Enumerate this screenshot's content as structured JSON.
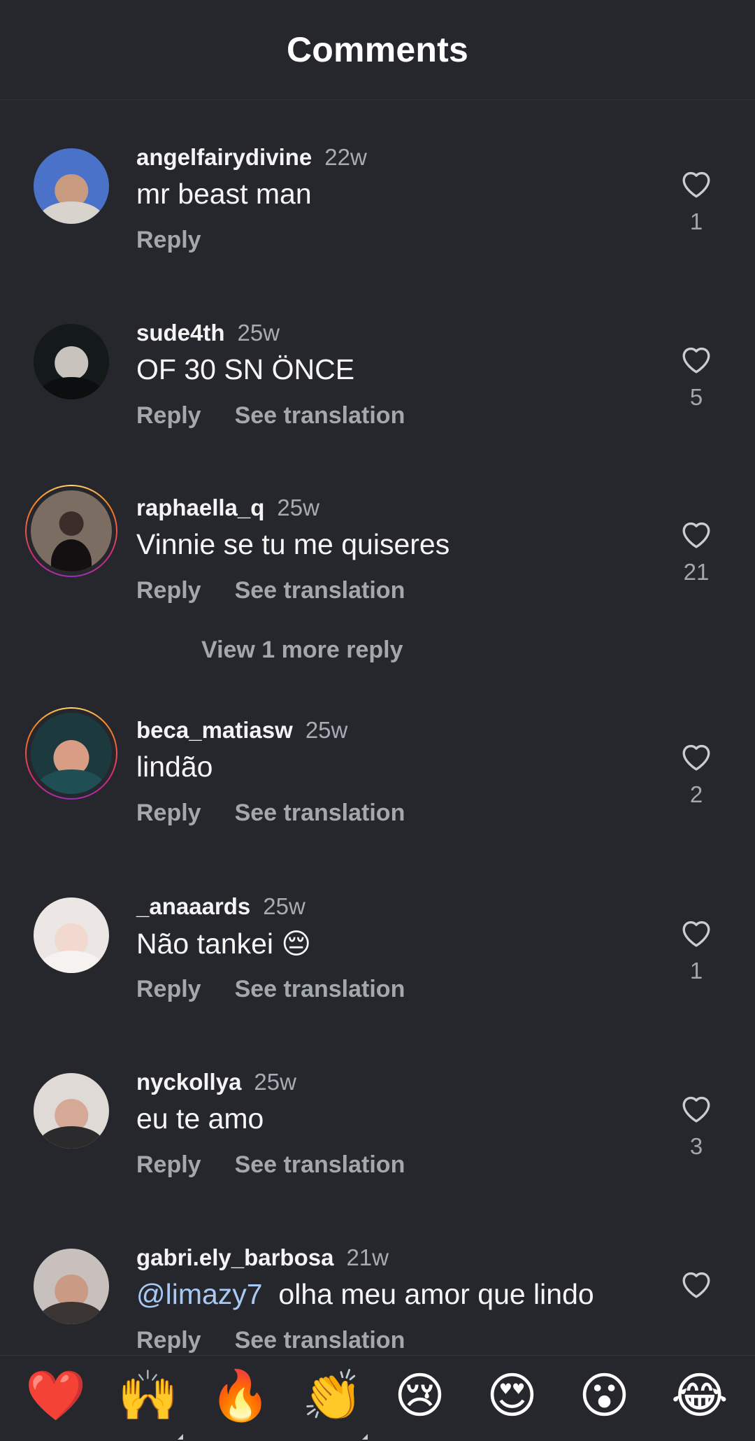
{
  "header": {
    "title": "Comments"
  },
  "comments": [
    {
      "username": "angelfairydivine",
      "time": "22w",
      "text": "mr beast man",
      "reply": "Reply",
      "translate": "",
      "likes": "1"
    },
    {
      "username": "sude4th",
      "time": "25w",
      "text": "OF 30 SN ÖNCE",
      "reply": "Reply",
      "translate": "See translation",
      "likes": "5"
    },
    {
      "username": "raphaella_q",
      "time": "25w",
      "text": "Vinnie se tu me quiseres",
      "reply": "Reply",
      "translate": "See translation",
      "likes": "21"
    },
    {
      "username": "beca_matiasw",
      "time": "25w",
      "text": "lindão",
      "reply": "Reply",
      "translate": "See translation",
      "likes": "2"
    },
    {
      "username": "_anaaards",
      "time": "25w",
      "text": "Não tankei 😔",
      "reply": "Reply",
      "translate": "See translation",
      "likes": "1"
    },
    {
      "username": "nyckollya",
      "time": "25w",
      "text": "eu te amo",
      "reply": "Reply",
      "translate": "See translation",
      "likes": "3"
    },
    {
      "username": "gabri.ely_barbosa",
      "time": "21w",
      "mention": "@limazy7",
      "text": "olha meu amor que lindo",
      "reply": "Reply",
      "translate": "See translation",
      "likes": ""
    }
  ],
  "view_more": "View 1 more reply",
  "emoji_bar": [
    "❤️",
    "🙌",
    "🔥",
    "👏",
    "😢",
    "😍",
    "😮",
    "😂"
  ],
  "icons": {
    "like": "heart-outline-icon"
  },
  "colors": {
    "background": "#25272c",
    "secondary_text": "#a3a7ae",
    "mention": "#a9c9f3"
  }
}
